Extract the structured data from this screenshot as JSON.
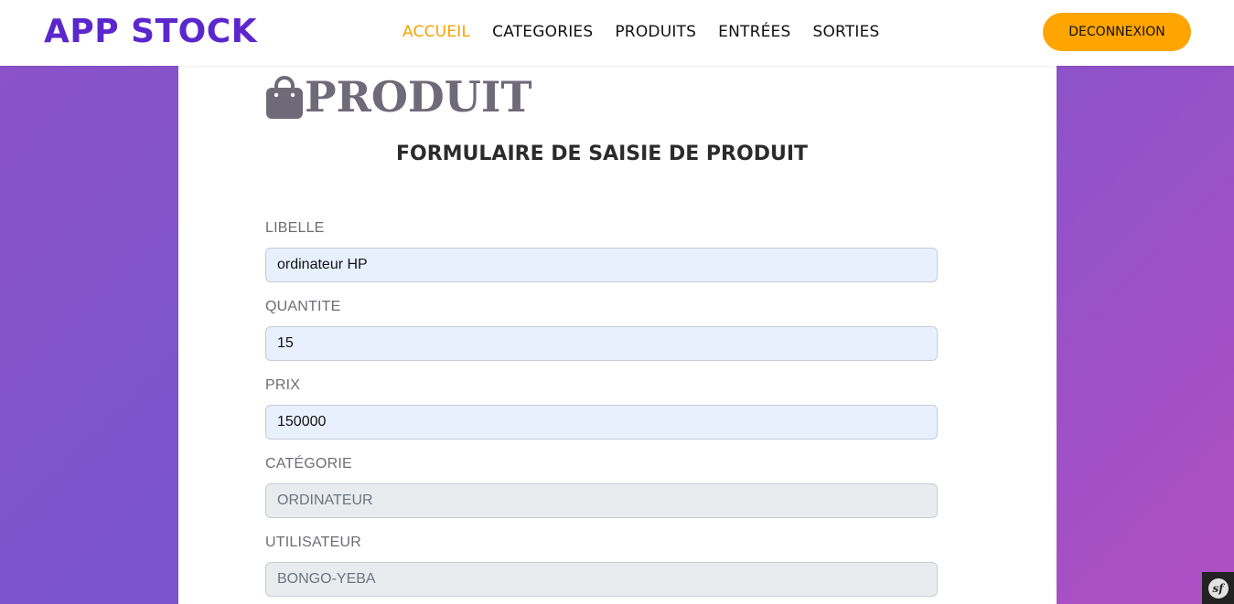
{
  "app": {
    "brand": "APP STOCK"
  },
  "nav": {
    "items": [
      {
        "label": "ACCUEIL",
        "active": true
      },
      {
        "label": "CATEGORIES",
        "active": false
      },
      {
        "label": "PRODUITS",
        "active": false
      },
      {
        "label": "ENTRÉES",
        "active": false
      },
      {
        "label": "SORTIES",
        "active": false
      }
    ],
    "logout_label": "DECONNEXION"
  },
  "page": {
    "heading": "PRODUIT",
    "heading_icon": "shopping-bag-icon",
    "form_title": "FORMULAIRE DE SAISIE DE PRODUIT"
  },
  "form": {
    "fields": [
      {
        "label": "LIBELLE",
        "value": "ordinateur HP",
        "disabled": false
      },
      {
        "label": "QUANTITE",
        "value": "15",
        "disabled": false
      },
      {
        "label": "PRIX",
        "value": "150000",
        "disabled": false
      },
      {
        "label": "CATÉGORIE",
        "value": "ORDINATEUR",
        "disabled": true
      },
      {
        "label": "UTILISATEUR",
        "value": "BONGO-YEBA",
        "disabled": true
      }
    ]
  },
  "toolbar": {
    "icon": "symfony-icon",
    "logo_text": "sf"
  },
  "colors": {
    "brand": "#5b27cc",
    "nav_active": "#f5a300",
    "logout_bg": "#ffa500",
    "input_bg": "#e8f0fe",
    "input_disabled_bg": "#e9ecef"
  }
}
